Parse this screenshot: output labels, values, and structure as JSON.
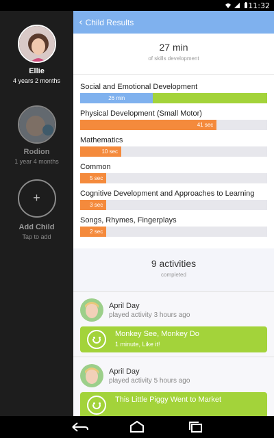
{
  "status_bar": {
    "time": "11:32",
    "icons": [
      "wifi-icon",
      "signal-icon",
      "battery-icon"
    ]
  },
  "sidebar": {
    "children": [
      {
        "name": "Ellie",
        "age": "4 years 2 months",
        "selected": true
      },
      {
        "name": "Rodion",
        "age": "1 year 4 months",
        "selected": false
      }
    ],
    "add_child": {
      "icon": "plus-icon",
      "symbol": "+",
      "label": "Add Child",
      "sub": "Tap to add"
    }
  },
  "header": {
    "back_icon": "chevron-left-icon",
    "title": "Child Results"
  },
  "summary": {
    "value": "27 min",
    "label": "of skills development"
  },
  "skills": [
    {
      "name": "Social and Emotional Development",
      "label": "26 min",
      "fraction": 0.39,
      "color": "blue",
      "rest_color": "green"
    },
    {
      "name": "Physical Development (Small Motor)",
      "label": "41 sec",
      "fraction": 0.73,
      "color": "orange"
    },
    {
      "name": "Mathematics",
      "label": "10 sec",
      "fraction": 0.22,
      "color": "orange"
    },
    {
      "name": "Common",
      "label": "5 sec",
      "fraction": 0.14,
      "color": "orange"
    },
    {
      "name": "Cognitive Development and Approaches to Learning",
      "label": "3 sec",
      "fraction": 0.14,
      "color": "orange"
    },
    {
      "name": "Songs, Rhymes, Fingerplays",
      "label": "2 sec",
      "fraction": 0.14,
      "color": "orange"
    }
  ],
  "activities_summary": {
    "value": "9 activities",
    "label": "completed"
  },
  "activities": [
    {
      "name": "April Day",
      "time": "played activity 3 hours ago",
      "title": "Monkey See, Monkey Do",
      "detail": "1 minute, Like it!",
      "icon": "smiley-icon"
    },
    {
      "name": "April Day",
      "time": "played activity 5 hours ago",
      "title": "This Little Piggy Went to Market",
      "detail": "",
      "icon": "smiley-icon"
    }
  ],
  "navbar": {
    "buttons": [
      "back-icon",
      "home-icon",
      "recents-icon"
    ]
  },
  "colors": {
    "accent": "#7fb1ee",
    "orange": "#f48a3c",
    "green": "#a3d33a",
    "track": "#e7e7ec"
  }
}
